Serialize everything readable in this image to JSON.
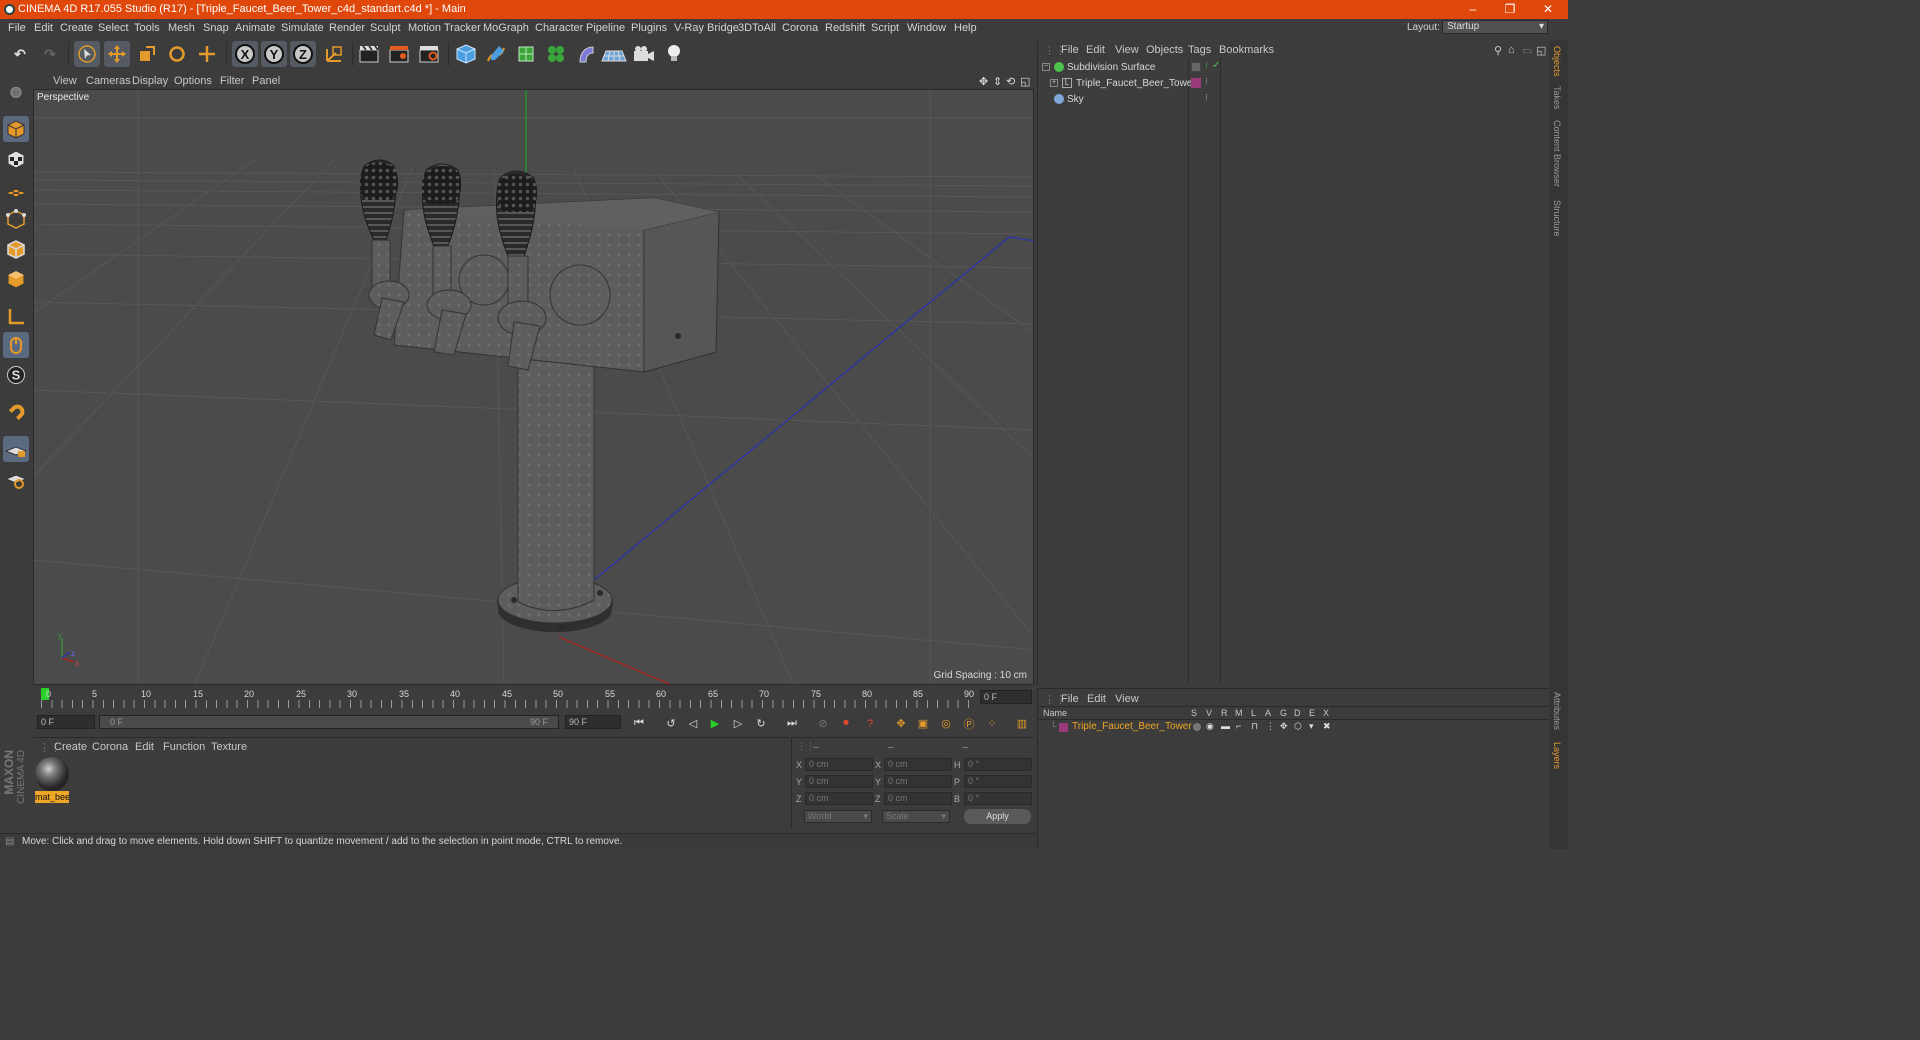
{
  "window": {
    "title": "CINEMA 4D R17.055 Studio (R17) - [Triple_Faucet_Beer_Tower_c4d_standart.c4d *] - Main",
    "controls": [
      "–",
      "❐",
      "✕"
    ]
  },
  "menubar": {
    "items": [
      "File",
      "Edit",
      "Create",
      "Select",
      "Tools",
      "Mesh",
      "Snap",
      "Animate",
      "Simulate",
      "Render",
      "Sculpt",
      "Motion Tracker",
      "MoGraph",
      "Character",
      "Pipeline",
      "Plugins",
      "V-Ray Bridge",
      "3DToAll",
      "Corona",
      "Redshift",
      "Script",
      "Window",
      "Help"
    ],
    "layout_label": "Layout:",
    "layout_value": "Startup"
  },
  "toolbar": {
    "axis_x": "X",
    "axis_y": "Y",
    "axis_z": "Z"
  },
  "viewport": {
    "menu": [
      "View",
      "Cameras",
      "Display",
      "Options",
      "Filter",
      "Panel"
    ],
    "label": "Perspective",
    "grid_spacing": "Grid Spacing : 10 cm",
    "axis_x": "x",
    "axis_y": "y",
    "axis_z": "z"
  },
  "object_manager": {
    "menu": [
      "File",
      "Edit",
      "View",
      "Objects",
      "Tags",
      "Bookmarks"
    ],
    "objects": [
      {
        "name": "Subdivision Surface",
        "color": "#4ec24e"
      },
      {
        "name": "Triple_Faucet_Beer_Tower",
        "color": "#c8c8c8"
      },
      {
        "name": "Sky",
        "color": "#7fa8d8"
      }
    ]
  },
  "right_tabs": [
    "Objects",
    "Takes",
    "Content Browser",
    "Structure",
    "Attributes",
    "Layers"
  ],
  "timeline": {
    "ticks": [
      "0",
      "5",
      "10",
      "15",
      "20",
      "25",
      "30",
      "35",
      "40",
      "45",
      "50",
      "55",
      "60",
      "65",
      "70",
      "75",
      "80",
      "85",
      "90"
    ],
    "current_frame": "0 F"
  },
  "transport": {
    "start_field": "0 F",
    "range_start": "0 F",
    "range_end": "90 F",
    "end_field": "90 F"
  },
  "material_manager": {
    "menu": [
      "Create",
      "Corona",
      "Edit",
      "Function",
      "Texture"
    ],
    "material_name": "mat_beer"
  },
  "coordinates": {
    "header": [
      "--",
      "--",
      "--"
    ],
    "rows": [
      {
        "a": "X",
        "a_val": "0 cm",
        "b": "X",
        "b_val": "0 cm",
        "c": "H",
        "c_val": "0 °"
      },
      {
        "a": "Y",
        "a_val": "0 cm",
        "b": "Y",
        "b_val": "0 cm",
        "c": "P",
        "c_val": "0 °"
      },
      {
        "a": "Z",
        "a_val": "0 cm",
        "b": "Z",
        "b_val": "0 cm",
        "c": "B",
        "c_val": "0 °"
      }
    ],
    "mode1": "World",
    "mode2": "Scale",
    "apply": "Apply"
  },
  "layer_manager": {
    "menu": [
      "File",
      "Edit",
      "View"
    ],
    "columns": [
      "Name",
      "S",
      "V",
      "R",
      "M",
      "L",
      "A",
      "G",
      "D",
      "E",
      "X"
    ],
    "layer_name": "Triple_Faucet_Beer_Tower"
  },
  "status": {
    "text": "Move: Click and drag to move elements. Hold down SHIFT to quantize movement / add to the selection in point mode, CTRL to remove."
  },
  "branding": {
    "text1": "MAXON",
    "text2": "CINEMA 4D"
  }
}
